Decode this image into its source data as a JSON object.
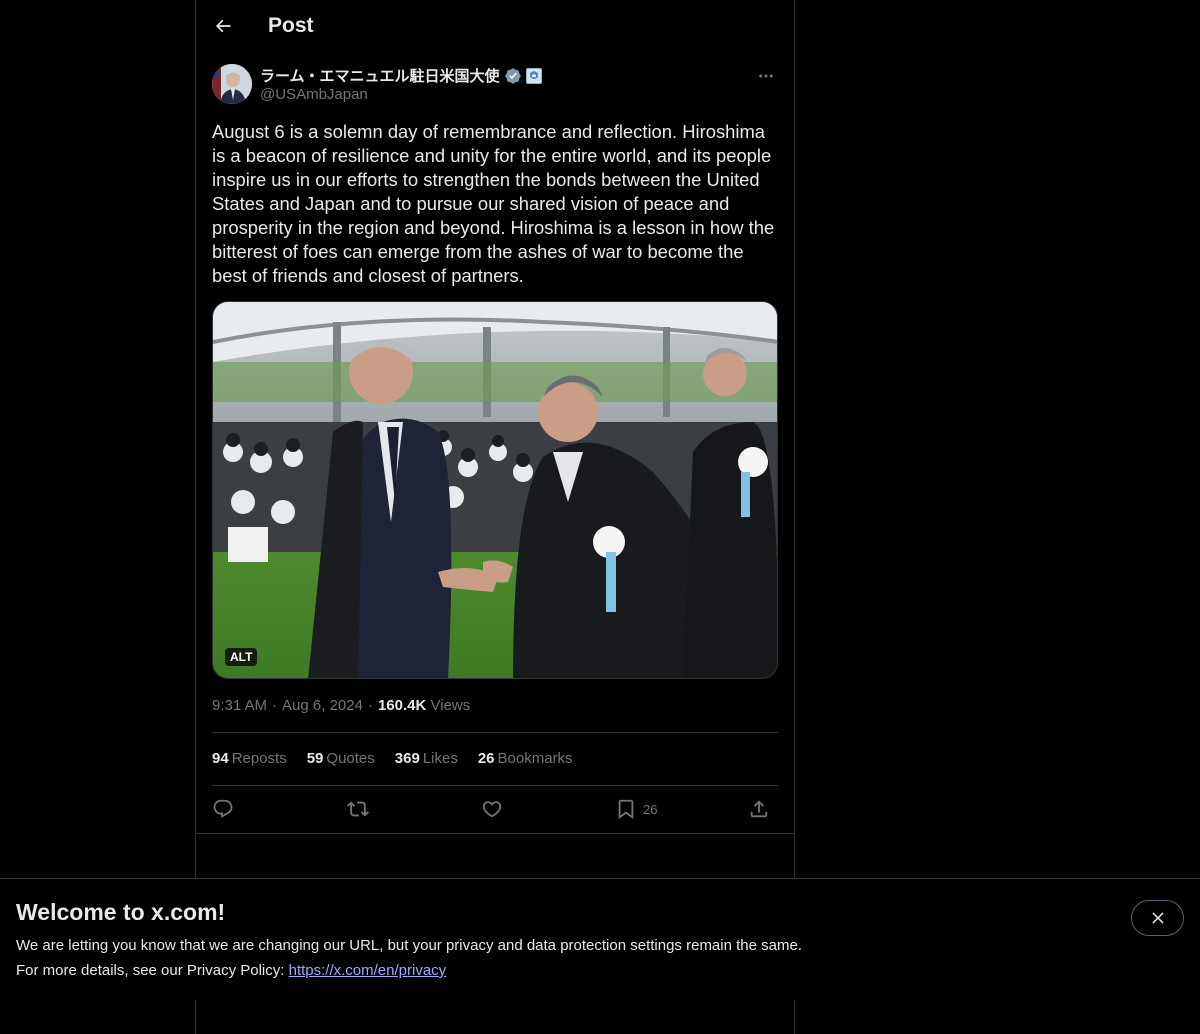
{
  "header": {
    "title": "Post"
  },
  "author": {
    "display_name": "ラーム・エマニュエル駐日米国大使",
    "handle": "@USAmbJapan"
  },
  "tweet": {
    "text": "August 6 is a solemn day of remembrance and reflection. Hiroshima is a beacon of resilience and unity for the entire world, and its people inspire us in our efforts to strengthen the bonds between the United States and Japan and to pursue our shared vision of peace and prosperity in the region and beyond. Hiroshima is a lesson in how the bitterest of foes can emerge from the ashes of war to become the best of friends and closest of partners.",
    "media_alt_badge": "ALT",
    "time": "9:31 AM",
    "date": "Aug 6, 2024",
    "views_count": "160.4K",
    "views_label": "Views"
  },
  "stats": [
    {
      "count": "94",
      "label": "Reposts"
    },
    {
      "count": "59",
      "label": "Quotes"
    },
    {
      "count": "369",
      "label": "Likes"
    },
    {
      "count": "26",
      "label": "Bookmarks"
    }
  ],
  "actions": {
    "bookmark_count": "26"
  },
  "banner": {
    "title": "Welcome to x.com!",
    "line1": "We are letting you know that we are changing our URL, but your privacy and data protection settings remain the same.",
    "line2_prefix": "For more details, see our Privacy Policy:",
    "link": "https://x.com/en/privacy"
  },
  "icons": [
    "back-arrow-icon",
    "verified-badge-icon",
    "government-affiliation-icon",
    "more-icon",
    "reply-icon",
    "repost-icon",
    "like-icon",
    "bookmark-icon",
    "share-icon",
    "close-icon"
  ],
  "colors": {
    "background": "#000000",
    "text": "#e7e9ea",
    "muted": "#71767b",
    "border": "#2f3336",
    "verified": "#829aab",
    "link": "#a3a8ff"
  }
}
